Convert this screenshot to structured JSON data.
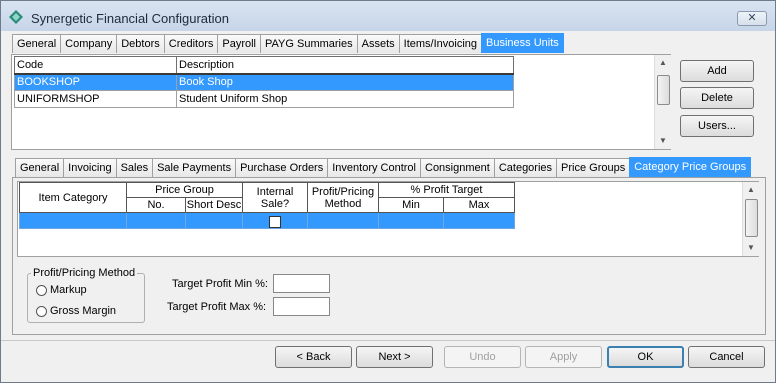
{
  "window": {
    "title": "Synergetic Financial Configuration",
    "close_glyph": "✕"
  },
  "top_tabs": [
    "General",
    "Company",
    "Debtors",
    "Creditors",
    "Payroll",
    "PAYG Summaries",
    "Assets",
    "Items/Invoicing",
    "Business Units"
  ],
  "top_tab_active": 8,
  "business_units": {
    "columns": [
      "Code",
      "Description"
    ],
    "rows": [
      {
        "code": "BOOKSHOP",
        "description": "Book Shop",
        "selected": true
      },
      {
        "code": "UNIFORMSHOP",
        "description": "Student Uniform Shop",
        "selected": false
      }
    ]
  },
  "side_buttons": {
    "add": "Add",
    "delete": "Delete",
    "users": "Users..."
  },
  "sub_tabs": [
    "General",
    "Invoicing",
    "Sales",
    "Sale Payments",
    "Purchase Orders",
    "Inventory Control",
    "Consignment",
    "Categories",
    "Price Groups",
    "Category Price Groups"
  ],
  "sub_tab_active": 9,
  "cpg_grid": {
    "item_category": "Item Category",
    "price_group": "Price Group",
    "pg_no": "No.",
    "pg_short": "Short Desc",
    "internal_sale": "Internal Sale?",
    "profit_method": "Profit/Pricing Method",
    "profit_target": "% Profit Target",
    "min": "Min",
    "max": "Max"
  },
  "profit_method_group": {
    "title": "Profit/Pricing Method",
    "options": [
      "Markup",
      "Gross Margin"
    ]
  },
  "target_fields": {
    "min_label": "Target Profit Min %:",
    "max_label": "Target Profit Max %:",
    "min_value": "",
    "max_value": ""
  },
  "footer_buttons": {
    "back": "< Back",
    "next": "Next >",
    "undo": "Undo",
    "apply": "Apply",
    "ok": "OK",
    "cancel": "Cancel"
  },
  "colors": {
    "selection": "#3399ff",
    "titlebar": "#c6d5e8"
  }
}
